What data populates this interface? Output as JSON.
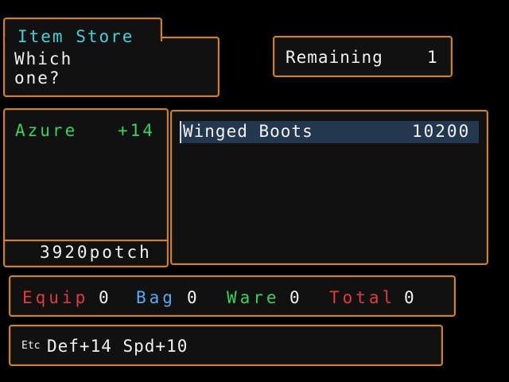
{
  "title": {
    "heading": "Item Store",
    "prompt_line1": "Which",
    "prompt_line2": "one?"
  },
  "remaining": {
    "label": "Remaining",
    "value": "1"
  },
  "character": {
    "name": "Azure",
    "bonus": "+14",
    "money": "3920potch"
  },
  "shop": {
    "items": [
      {
        "name": "Winged Boots",
        "price": "10200"
      }
    ],
    "selected_index": 0
  },
  "counts": {
    "equip_label": "Equip",
    "equip_value": "0",
    "bag_label": "Bag",
    "bag_value": "0",
    "ware_label": "Ware",
    "ware_value": "0",
    "total_label": "Total",
    "total_value": "0"
  },
  "effect": {
    "icon_label": "Etc",
    "text": "Def+14 Spd+10"
  },
  "colors": {
    "frame": "#c8823a",
    "heading": "#46cfd6",
    "character": "#3ad25a",
    "equip": "#e33b3b",
    "bag": "#58a8f2",
    "ware": "#3ad25a",
    "total": "#e33b3b",
    "highlight": "#23384f"
  }
}
